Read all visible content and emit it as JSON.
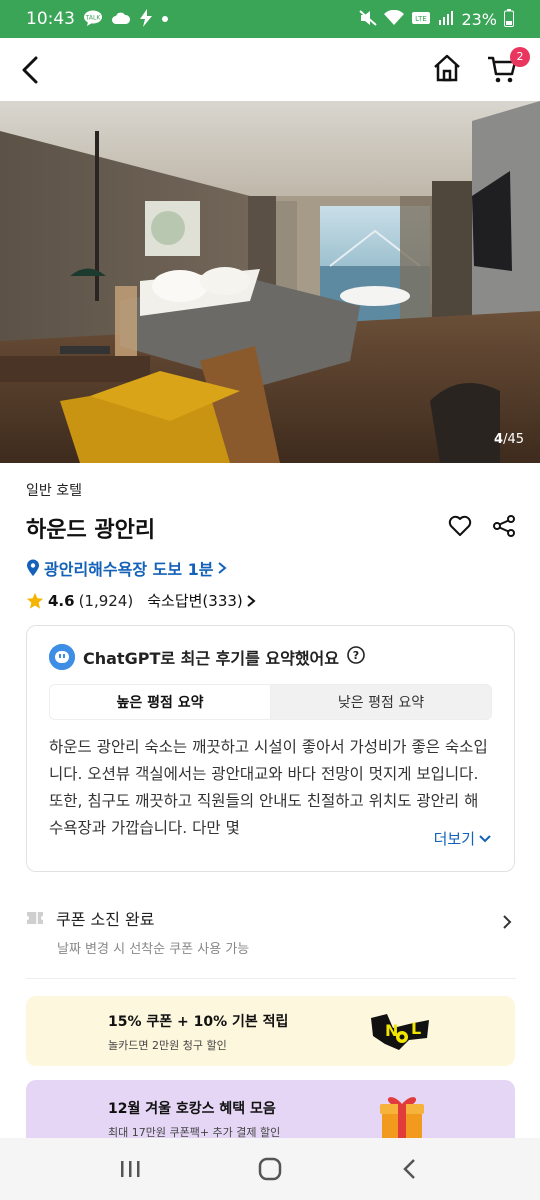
{
  "status_bar": {
    "time": "10:43",
    "battery": "23%"
  },
  "nav": {
    "cart_count": "2"
  },
  "hero": {
    "current_photo": "4",
    "total_photos": "/45"
  },
  "hotel": {
    "category": "일반 호텔",
    "name": "하운드 광안리",
    "location": "광안리해수욕장 도보 1분",
    "rating": "4.6",
    "review_count": "(1,924)",
    "host_replies": "숙소답변(333)"
  },
  "ai_summary": {
    "heading": "ChatGPT로 최근 후기를 요약했어요",
    "tabs": [
      {
        "label": "높은 평점 요약"
      },
      {
        "label": "낮은 평점 요약"
      }
    ],
    "text": "하운드 광안리 숙소는 깨끗하고 시설이 좋아서 가성비가 좋은 숙소입니다. 오션뷰 객실에서는 광안대교와 바다 전망이 멋지게 보입니다. 또한, 침구도 깨끗하고 직원들의 안내도 친절하고 위치도 광안리 해수욕장과 가깝습니다. 다만 몇",
    "more_label": "더보기"
  },
  "coupon": {
    "title": "쿠폰 소진 완료",
    "subtitle": "날짜 변경 시 선착순 쿠폰 사용 가능"
  },
  "banners": [
    {
      "title": "15% 쿠폰 + 10% 기본 적립",
      "subtitle": "놀카드면 2만원 청구 할인",
      "background": "#fdf7dd"
    },
    {
      "title": "12월 겨울 호캉스 혜택 모음",
      "subtitle": "최대 17만원 쿠폰팩+ 추가 결제 할인",
      "background": "#e4d6f4"
    }
  ],
  "colors": {
    "status_bar": "#3aa457",
    "link_blue": "#1361b8",
    "badge": "#e8365e",
    "star": "#f5b400"
  }
}
